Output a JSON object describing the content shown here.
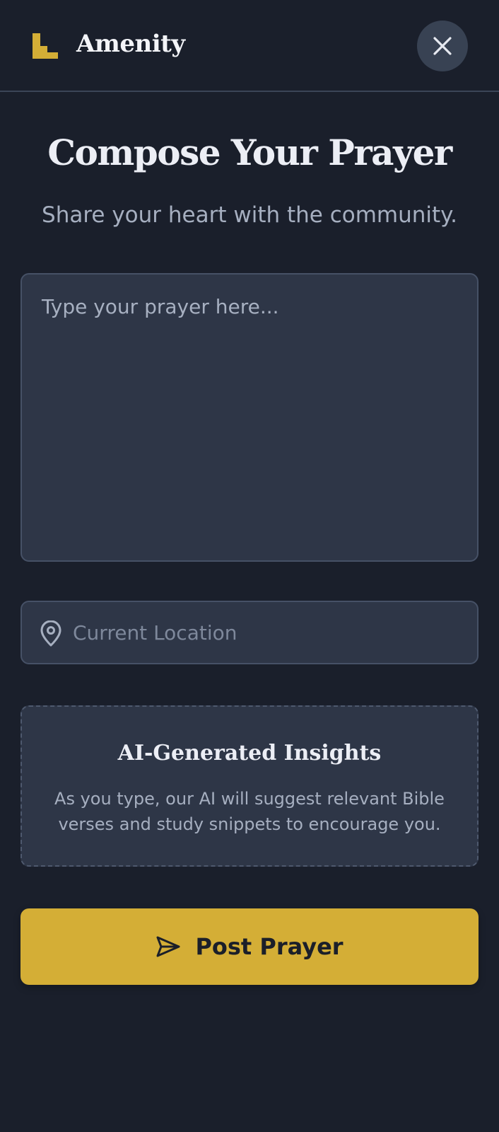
{
  "header": {
    "brand": "Amenity",
    "logo_icon": "stair-logo-icon",
    "close_icon": "close-icon"
  },
  "page": {
    "title": "Compose Your Prayer",
    "subtitle": "Share your heart with the community."
  },
  "prayer_input": {
    "placeholder": "Type your prayer here...",
    "value": ""
  },
  "location_input": {
    "placeholder": "Current Location",
    "value": "",
    "icon": "map-pin-icon"
  },
  "insights": {
    "title": "AI-Generated Insights",
    "text": "As you type, our AI will suggest relevant Bible verses and study snippets to encourage you."
  },
  "post_button": {
    "label": "Post Prayer",
    "icon": "send-icon"
  },
  "colors": {
    "background": "#1a1f2b",
    "surface": "#2e3647",
    "accent": "#d4ae36",
    "text_primary": "#eceef5",
    "text_secondary": "#a6afc0"
  }
}
